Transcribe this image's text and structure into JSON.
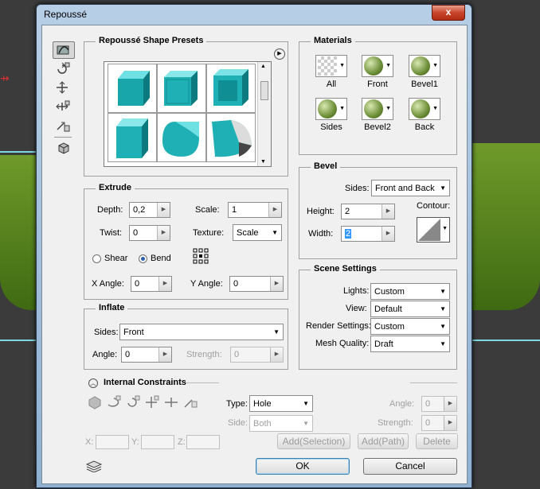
{
  "window": {
    "title": "Repoussé",
    "close_symbol": "x"
  },
  "left_tools": [
    "repousse-tool-icon",
    "rotate-constraint-icon",
    "move-constraint-icon",
    "scale-constraint-icon",
    "tool-4-icon",
    "cube-tool-icon"
  ],
  "presets": {
    "title": "Repoussé Shape Presets",
    "menu_symbol": "▶"
  },
  "extrude": {
    "title": "Extrude",
    "depth_label": "Depth:",
    "depth_value": "0,2",
    "scale_label": "Scale:",
    "scale_value": "1",
    "twist_label": "Twist:",
    "twist_value": "0",
    "texture_label": "Texture:",
    "texture_value": "Scale",
    "shear_label": "Shear",
    "bend_label": "Bend",
    "selected_mode": "Bend",
    "x_angle_label": "X Angle:",
    "x_angle_value": "0",
    "y_angle_label": "Y Angle:",
    "y_angle_value": "0"
  },
  "inflate": {
    "title": "Inflate",
    "sides_label": "Sides:",
    "sides_value": "Front",
    "angle_label": "Angle:",
    "angle_value": "0",
    "strength_label": "Strength:",
    "strength_value": "0"
  },
  "materials": {
    "title": "Materials",
    "items": [
      {
        "label": "All",
        "swatch": "empty"
      },
      {
        "label": "Front",
        "swatch": "sphere"
      },
      {
        "label": "Bevel1",
        "swatch": "sphere"
      },
      {
        "label": "Sides",
        "swatch": "sphere"
      },
      {
        "label": "Bevel2",
        "swatch": "sphere"
      },
      {
        "label": "Back",
        "swatch": "sphere"
      }
    ]
  },
  "bevel": {
    "title": "Bevel",
    "sides_label": "Sides:",
    "sides_value": "Front and Back",
    "height_label": "Height:",
    "height_value": "2",
    "width_label": "Width:",
    "width_value": "2",
    "contour_label": "Contour:"
  },
  "scene": {
    "title": "Scene Settings",
    "lights_label": "Lights:",
    "lights_value": "Custom",
    "view_label": "View:",
    "view_value": "Default",
    "render_label": "Render Settings:",
    "render_value": "Custom",
    "mesh_label": "Mesh Quality:",
    "mesh_value": "Draft"
  },
  "constraints": {
    "title": "Internal Constraints",
    "type_label": "Type:",
    "type_value": "Hole",
    "side_label": "Side:",
    "side_value": "Both",
    "angle_label": "Angle:",
    "angle_value": "0",
    "strength_label": "Strength:",
    "strength_value": "0",
    "x_label": "X:",
    "y_label": "Y:",
    "z_label": "Z:",
    "add_selection": "Add(Selection)",
    "add_path": "Add(Path)",
    "delete": "Delete"
  },
  "buttons": {
    "ok": "OK",
    "cancel": "Cancel"
  },
  "colors": {
    "teal": "#1fb0b5",
    "title_gradient": "#b7cfe6",
    "bg_green": "#5a8a22"
  }
}
